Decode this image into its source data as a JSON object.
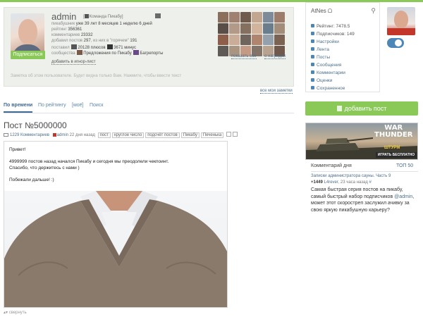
{
  "profile": {
    "username": "admin",
    "team_prefix": "[",
    "team": "Команда Пикабу",
    "team_suffix": "]",
    "on_pikabu_label": "пикабушник",
    "on_pikabu_value": "уже 39 лет 8 месяцев 1 неделю 6 дней",
    "rating_label": "рейтинг",
    "rating_value": "356361",
    "comments_label": "комментариев",
    "comments_value": "23332",
    "posts_label": "добавил постов",
    "posts_value": "297",
    "hot_label": ", из них в \"горячем\"",
    "hot_value": "191",
    "likes_label": "поставил",
    "pluses_value": "20128 плюсов",
    "minuses_value": "3671 минус",
    "communities_label": "сообщества",
    "community_1": "Предложения по Пикабу",
    "community_2": "Багрепорты",
    "subscribe_label": "Подписаться",
    "ignore_label": "добавить в игнор-лист",
    "note_placeholder": "Заметка об этом пользователе. Будет видна только Вам. Нажмите, чтобы ввести текст",
    "show_all_label": "показать все",
    "rewards_label": "о наградах",
    "all_notes_label": "все мои заметки",
    "subscriber_colors": [
      "#8b6f5c",
      "#a08070",
      "#6f5a4e",
      "#c2a68f",
      "#7d8a9a",
      "#9c7c6a",
      "#5a4e48",
      "#b39a88",
      "#85705f",
      "#d2b39c",
      "#6a7d8c",
      "#a28c7a",
      "#8d5f4a",
      "#c9ad98",
      "#70655d",
      "#b08570",
      "#94a0ac",
      "#7b6353",
      "#5f5a55",
      "#a99582",
      "#c49a84",
      "#827468",
      "#b8a290",
      "#6e594c"
    ]
  },
  "tabs": [
    {
      "label": "По времени",
      "active": true
    },
    {
      "label": "По рейтингу",
      "active": false
    },
    {
      "label": "[моё]",
      "active": false
    },
    {
      "label": "Поиск",
      "active": false
    }
  ],
  "post": {
    "title": "Пост №5000000",
    "comments": "1229 Комментариев",
    "author": "admin",
    "time": "22 дня назад",
    "tags": [
      "пост",
      "круглое число",
      "подсчёт постов",
      "Пикабу",
      "Печенька"
    ],
    "text": [
      "Привет!",
      "",
      "4999999 постов назад начался Пикабу и сегодня мы преодолели чекпоинт.",
      "Спасибо, что держитесь с нами )",
      "",
      "Побежали дальше! :)"
    ],
    "collapse_label": "свернуть"
  },
  "sidebar": {
    "user": "AtNes",
    "menu": [
      "Рейтинг: 7478.5",
      "Подписчиков: 149",
      "Настройки",
      "Лента",
      "Посты",
      "Сообщения",
      "Комментарии",
      "Оценки",
      "Сохраненное"
    ],
    "add_post_label": "добавить пост",
    "ad": {
      "title_line1": "WAR",
      "title_line2": "THUNDER",
      "subtitle": "ШТУРМ",
      "button": "ИГРАТЬ БЕСПЛАТНО"
    },
    "comment_of_day": {
      "heading": "Комментарий дня",
      "top_link": "ТОП 50",
      "post_link": "Записки администратора сауны. Часть 9",
      "score": "+1449",
      "author": "L4rever",
      "time": ", 23 часа назад",
      "hash": "#",
      "text_1": "Самая быстрая серия постов на пикабу, самый быстрый набор подписчиков",
      "mention": "@admin",
      "text_2": ", может этот скоростреп заслужил ачивку за свою яркую пикабушную карьеру?"
    }
  },
  "colors": {
    "accent_green": "#8ac858",
    "link_blue": "#4d6f8a"
  }
}
